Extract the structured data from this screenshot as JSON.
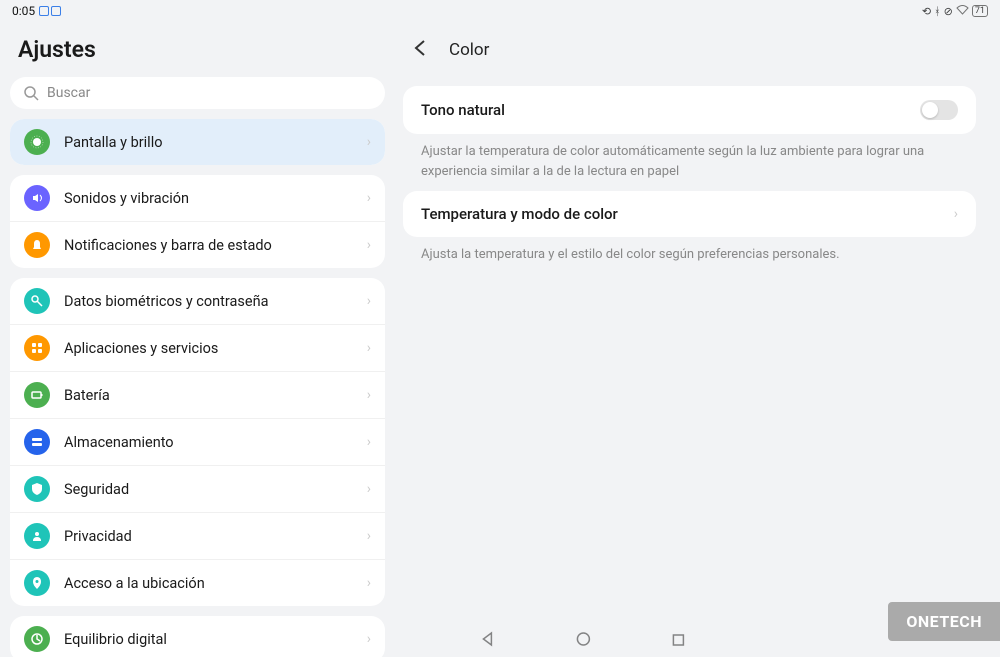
{
  "statusbar": {
    "time": "0:05",
    "battery": "71"
  },
  "sidebar": {
    "title": "Ajustes",
    "search_placeholder": "Buscar",
    "items": [
      {
        "label": "Pantalla y brillo",
        "icon": "display-icon",
        "color": "#4caf50",
        "selected": true
      },
      {
        "label": "Sonidos y vibración",
        "icon": "sound-icon",
        "color": "#6b63ff",
        "selected": false
      },
      {
        "label": "Notificaciones y barra de estado",
        "icon": "bell-icon",
        "color": "#ff9800",
        "selected": false
      },
      {
        "label": "Datos biométricos y contraseña",
        "icon": "key-icon",
        "color": "#1fc4b8",
        "selected": false
      },
      {
        "label": "Aplicaciones y servicios",
        "icon": "apps-icon",
        "color": "#ff9800",
        "selected": false
      },
      {
        "label": "Batería",
        "icon": "battery-icon",
        "color": "#4caf50",
        "selected": false
      },
      {
        "label": "Almacenamiento",
        "icon": "storage-icon",
        "color": "#2563eb",
        "selected": false
      },
      {
        "label": "Seguridad",
        "icon": "shield-icon",
        "color": "#1fc4b8",
        "selected": false
      },
      {
        "label": "Privacidad",
        "icon": "privacy-icon",
        "color": "#1fc4b8",
        "selected": false
      },
      {
        "label": "Acceso a la ubicación",
        "icon": "location-icon",
        "color": "#1fc4b8",
        "selected": false
      },
      {
        "label": "Equilibrio digital",
        "icon": "balance-icon",
        "color": "#4caf50",
        "selected": false
      }
    ]
  },
  "detail": {
    "title": "Color",
    "natural_tone": {
      "label": "Tono natural",
      "description": "Ajustar la temperatura de color automáticamente según la luz ambiente para lograr una experiencia similar a la de la lectura en papel",
      "enabled": false
    },
    "color_mode": {
      "label": "Temperatura y modo de color",
      "description": "Ajusta la temperatura y el estilo del color según preferencias personales."
    }
  },
  "watermark": "ONETECH"
}
